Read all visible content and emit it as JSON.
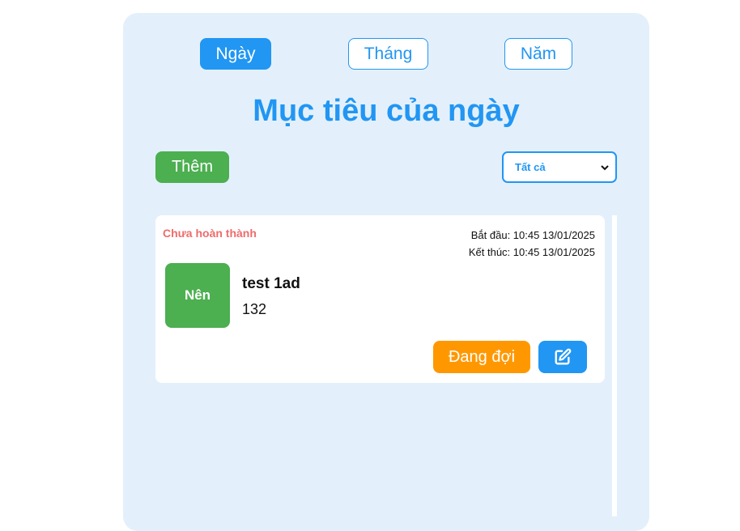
{
  "tabs": [
    {
      "label": "Ngày",
      "active": true
    },
    {
      "label": "Tháng",
      "active": false
    },
    {
      "label": "Năm",
      "active": false
    }
  ],
  "page_title": "Mục tiêu của ngày",
  "toolbar": {
    "add_label": "Thêm",
    "filter_selected": "Tất cả"
  },
  "goals": [
    {
      "status": "Chưa hoàn thành",
      "start": "Bắt đầu: 10:45 13/01/2025",
      "end": "Kết thúc: 10:45 13/01/2025",
      "badge": "Nên",
      "title": "test 1ad",
      "description": "132",
      "action_label": "Đang đợi",
      "edit_icon": "edit-icon"
    }
  ],
  "colors": {
    "accent": "#2196f3",
    "add": "#4caf50",
    "waiting": "#ff9800",
    "status_incomplete": "#ef6b6b",
    "panel": "#e3f0fb"
  }
}
